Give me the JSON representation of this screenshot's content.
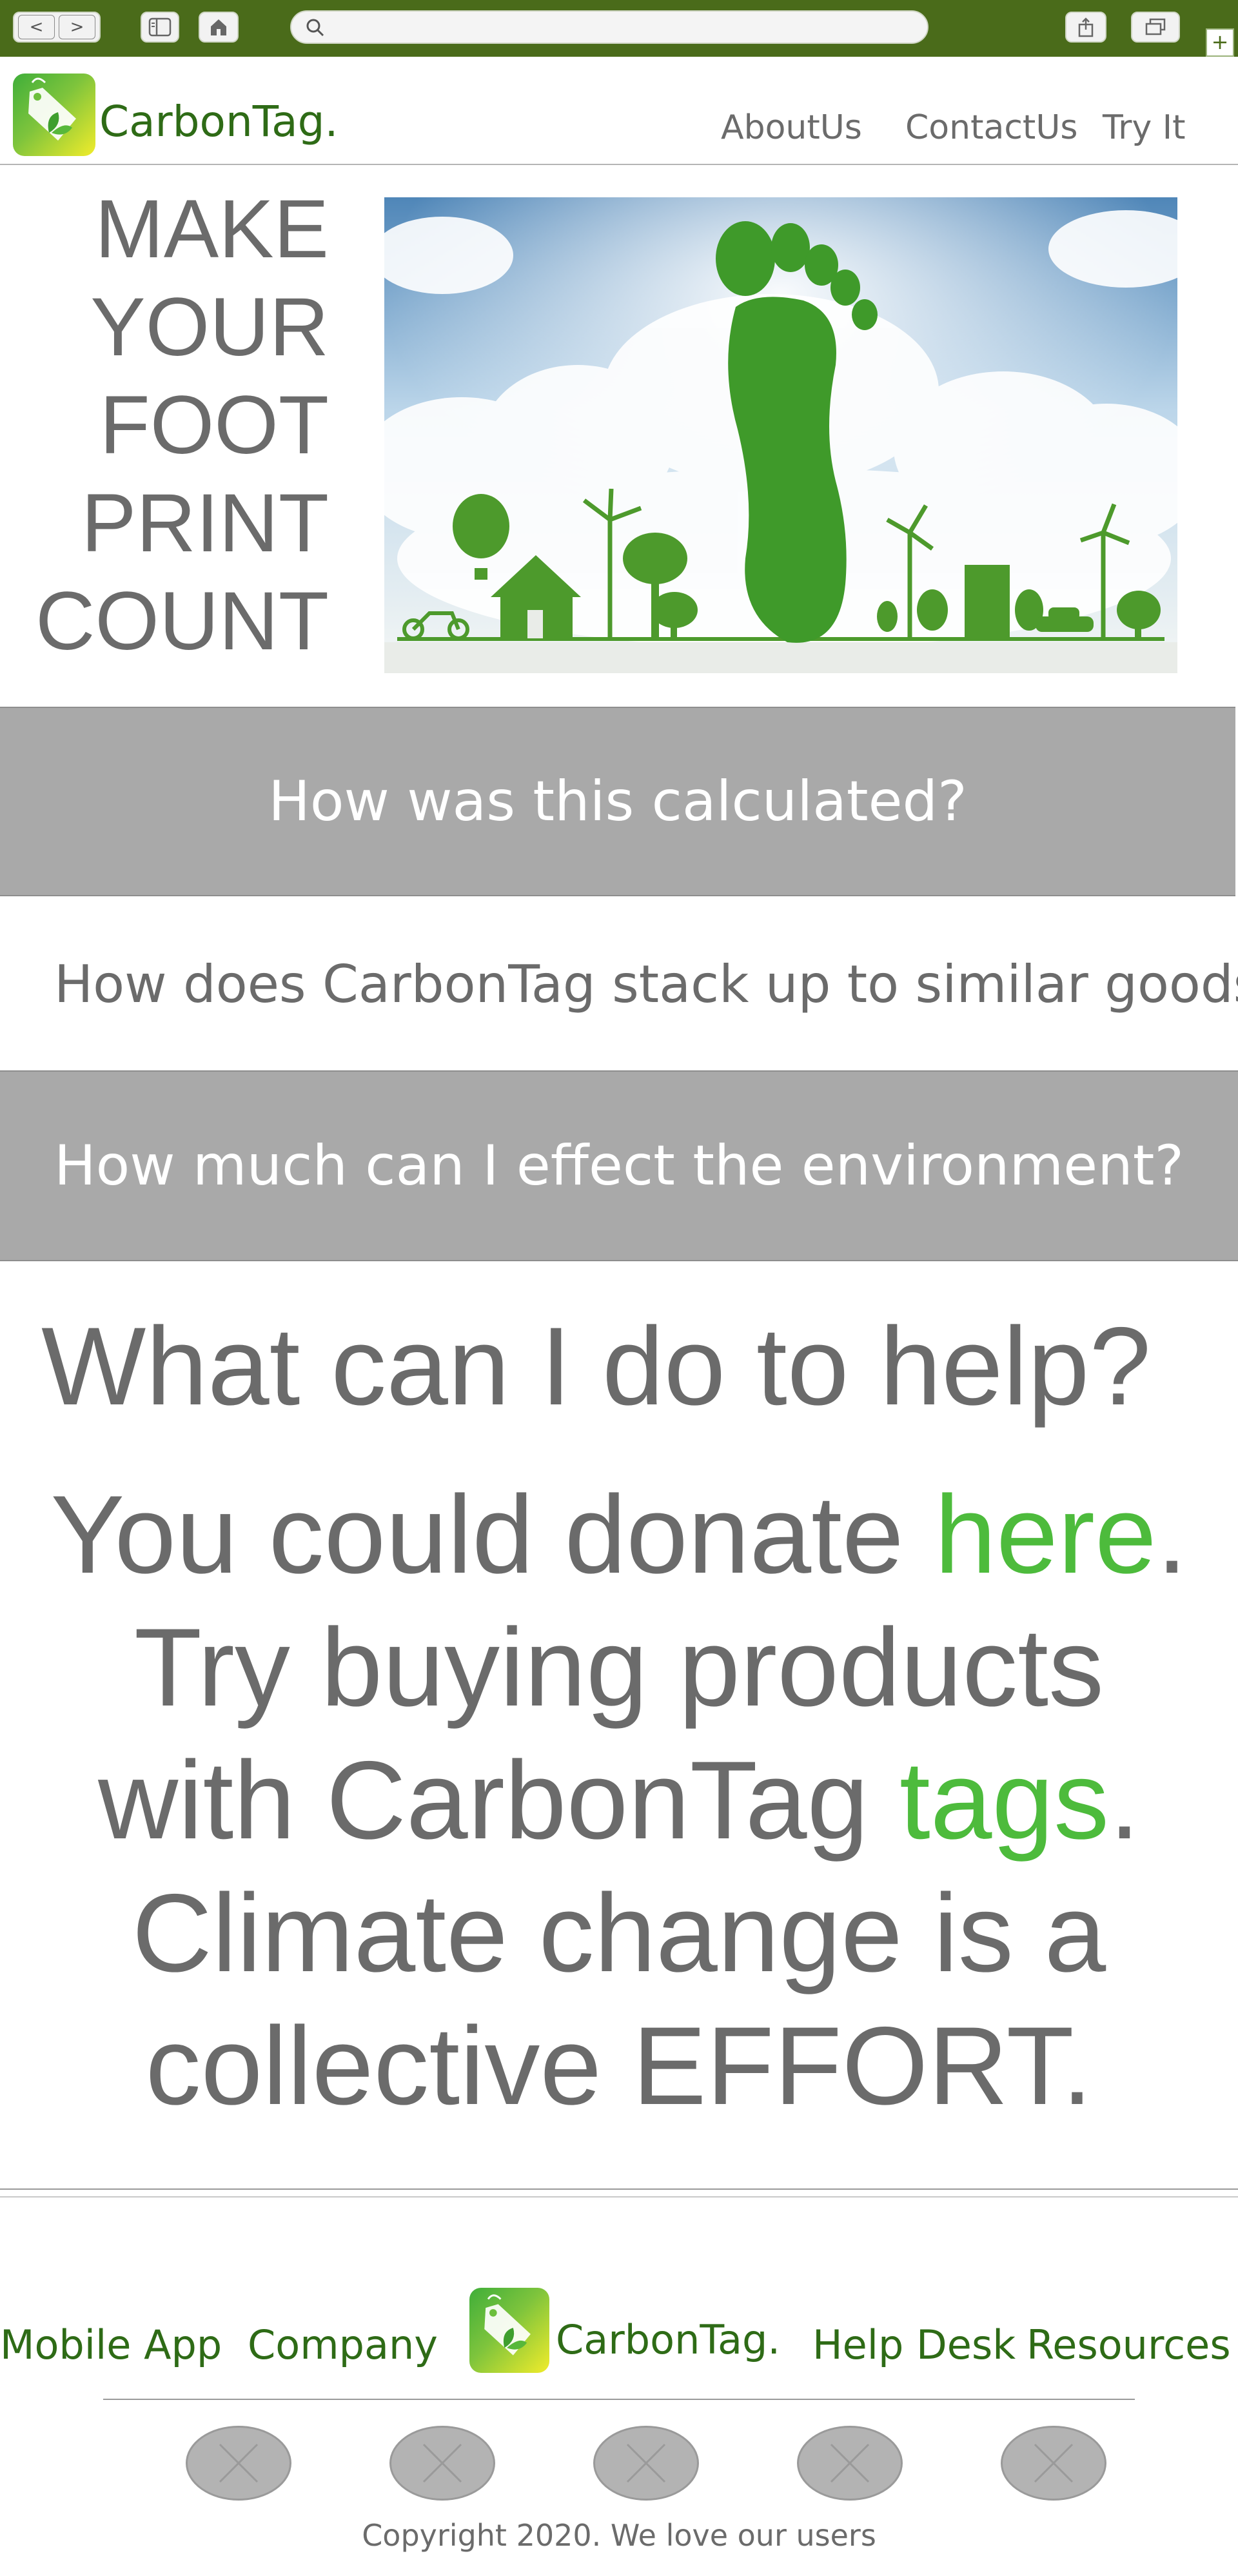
{
  "browser": {
    "back_label": "<",
    "forward_label": ">",
    "new_tab_label": "+"
  },
  "header": {
    "brand": "CarbonTag.",
    "nav": [
      "AboutUs",
      "ContactUs",
      "Try It"
    ]
  },
  "hero": {
    "lines": [
      "MAKE",
      "YOUR",
      "FOOT",
      "PRINT",
      "COUNT"
    ]
  },
  "faq": [
    "How was this calculated?",
    "How does CarbonTag stack up to similar goods?",
    "How much can I effect the environment?"
  ],
  "help": {
    "title": "What can I do to help?",
    "line1_pre": "You could donate ",
    "line1_link": "here",
    "line1_post": ".",
    "line2": "Try buying products",
    "line3_pre": "with CarbonTag ",
    "line3_link": "tags",
    "line3_post": ".",
    "line4": "Climate change is a",
    "line5": "collective EFFORT."
  },
  "footer": {
    "links": [
      "Mobile App",
      "Company",
      "Help Desk",
      "Resources"
    ],
    "brand": "CarbonTag.",
    "copyright": "Copyright 2020. We love our users"
  },
  "colors": {
    "chrome": "#4a6b1a",
    "brand_green": "#2e6b16",
    "link_green": "#4dbb3c",
    "faq_bar": "#a9a9a9",
    "text_gray": "#6b6b6b"
  }
}
